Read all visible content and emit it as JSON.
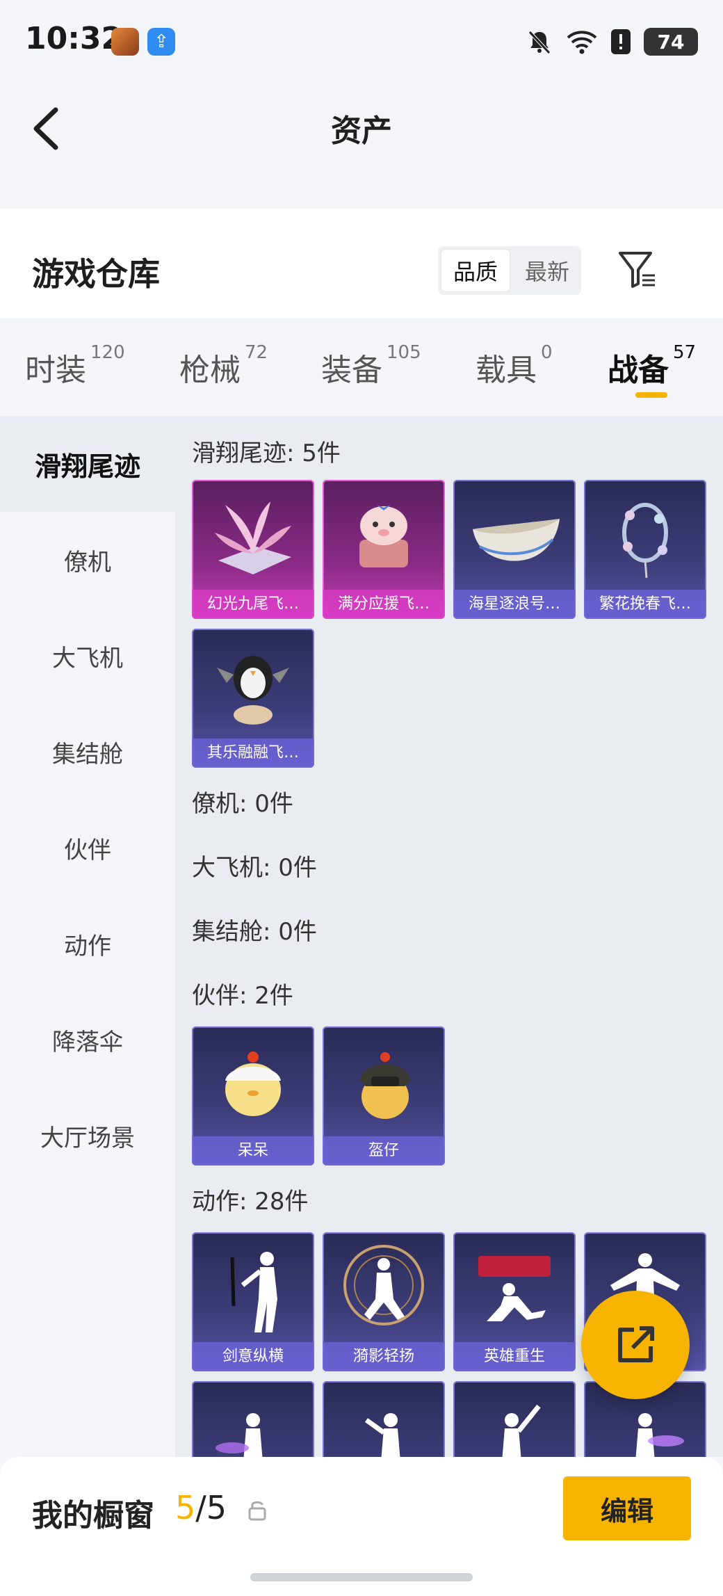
{
  "status_bar": {
    "time": "10:32",
    "battery": "74"
  },
  "header": {
    "title": "资产"
  },
  "warehouse": {
    "title": "游戏仓库",
    "sort_options": [
      "品质",
      "最新"
    ]
  },
  "tabs": [
    {
      "label": "时装",
      "count": "120"
    },
    {
      "label": "枪械",
      "count": "72"
    },
    {
      "label": "装备",
      "count": "105"
    },
    {
      "label": "载具",
      "count": "0"
    },
    {
      "label": "战备",
      "count": "57"
    }
  ],
  "sidebar": [
    {
      "label": "滑翔尾迹"
    },
    {
      "label": "僚机"
    },
    {
      "label": "大飞机"
    },
    {
      "label": "集结舱"
    },
    {
      "label": "伙伴"
    },
    {
      "label": "动作"
    },
    {
      "label": "降落伞"
    },
    {
      "label": "大厅场景"
    }
  ],
  "sections": {
    "glide": {
      "title": "滑翔尾迹: 5件",
      "items": [
        "幻光九尾飞…",
        "满分应援飞…",
        "海星逐浪号…",
        "繁花挽春飞…",
        "其乐融融飞…"
      ]
    },
    "wingman": {
      "title": "僚机: 0件"
    },
    "plane": {
      "title": "大飞机: 0件"
    },
    "pod": {
      "title": "集结舱: 0件"
    },
    "partner": {
      "title": "伙伴: 2件",
      "items": [
        "呆呆",
        "盔仔"
      ]
    },
    "emote": {
      "title": "动作: 28件",
      "items": [
        "剑意纵横",
        "漪影轻扬",
        "英雄重生"
      ]
    }
  },
  "showcase": {
    "title": "我的橱窗",
    "current": "5",
    "total": "/5",
    "edit_label": "编辑"
  },
  "colors": {
    "accent": "#f6b300",
    "card_purple": "#3d3e7a",
    "card_pink": "#8a2b86"
  }
}
